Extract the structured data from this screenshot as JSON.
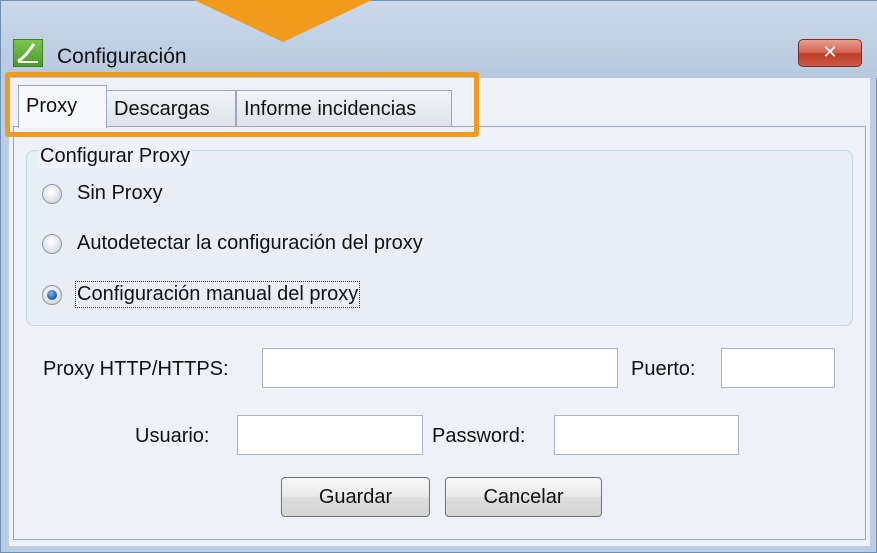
{
  "window": {
    "title": "Configuración",
    "close_glyph": "✕"
  },
  "tabs": [
    {
      "label": "Proxy",
      "active": true
    },
    {
      "label": "Descargas",
      "active": false
    },
    {
      "label": "Informe incidencias",
      "active": false
    }
  ],
  "proxy_group": {
    "label": "Configurar Proxy",
    "options": [
      {
        "label": "Sin Proxy",
        "selected": false
      },
      {
        "label": "Autodetectar la configuración del proxy",
        "selected": false
      },
      {
        "label": "Configuración manual del proxy",
        "selected": true
      }
    ]
  },
  "fields": {
    "proxy_label": "Proxy HTTP/HTTPS:",
    "proxy_value": "",
    "port_label": "Puerto:",
    "port_value": "",
    "user_label": "Usuario:",
    "user_value": "",
    "password_label": "Password:",
    "password_value": ""
  },
  "buttons": {
    "save": "Guardar",
    "cancel": "Cancelar"
  },
  "colors": {
    "highlight": "#f29a1b",
    "close_button": "#c9503c"
  },
  "icons": {
    "app": "app-logo-icon",
    "close": "close-icon"
  }
}
